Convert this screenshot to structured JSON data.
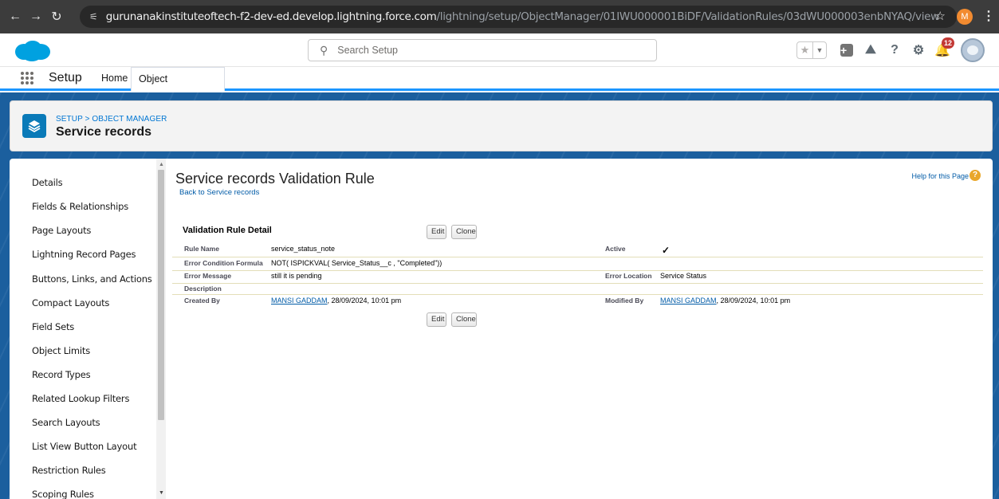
{
  "browser": {
    "url_host": "gurunanakinstituteoftech-f2-dev-ed.develop.lightning.force.com",
    "url_path": "/lightning/setup/ObjectManager/01IWU000001BiDF/ValidationRules/03dWU000003enbNYAQ/view",
    "profile_initial": "M"
  },
  "header": {
    "search_placeholder": "Search Setup",
    "notification_count": "12"
  },
  "nav": {
    "app_name": "Setup",
    "tabs": [
      {
        "label": "Home"
      },
      {
        "label": "Object Manager"
      }
    ]
  },
  "object_header": {
    "breadcrumb_setup": "SETUP",
    "breadcrumb_sep": ">",
    "breadcrumb_object_manager": "OBJECT MANAGER",
    "title": "Service records"
  },
  "sidebar": {
    "items": [
      "Details",
      "Fields & Relationships",
      "Page Layouts",
      "Lightning Record Pages",
      "Buttons, Links, and Actions",
      "Compact Layouts",
      "Field Sets",
      "Object Limits",
      "Record Types",
      "Related Lookup Filters",
      "Search Layouts",
      "List View Button Layout",
      "Restriction Rules",
      "Scoping Rules"
    ]
  },
  "page": {
    "title": "Service records Validation Rule",
    "back_link": "Back to Service records",
    "help_link": "Help for this Page",
    "section_title": "Validation Rule Detail",
    "edit_label": "Edit",
    "clone_label": "Clone"
  },
  "detail": {
    "rule_name_label": "Rule Name",
    "rule_name_value": "service_status_note",
    "active_label": "Active",
    "active_value": "✓",
    "formula_label": "Error Condition Formula",
    "formula_value": "NOT( ISPICKVAL( Service_Status__c , \"Completed\"))",
    "error_message_label": "Error Message",
    "error_message_value": "still it is pending",
    "error_location_label": "Error Location",
    "error_location_value": "Service Status",
    "description_label": "Description",
    "created_by_label": "Created By",
    "created_by_user": "MANSI GADDAM",
    "created_by_date": ", 28/09/2024, 10:01 pm",
    "modified_by_label": "Modified By",
    "modified_by_user": "MANSI GADDAM",
    "modified_by_date": ", 28/09/2024, 10:01 pm"
  }
}
